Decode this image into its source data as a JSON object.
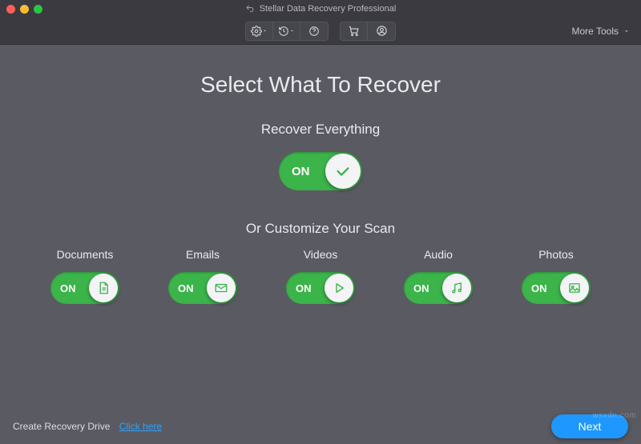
{
  "window": {
    "title": "Stellar Data Recovery Professional"
  },
  "toolbar": {
    "more_tools_label": "More Tools"
  },
  "main": {
    "heading": "Select What To Recover",
    "recover_everything_label": "Recover Everything",
    "customize_label": "Or Customize Your Scan",
    "toggle_on_label": "ON"
  },
  "categories": [
    {
      "key": "documents",
      "label": "Documents"
    },
    {
      "key": "emails",
      "label": "Emails"
    },
    {
      "key": "videos",
      "label": "Videos"
    },
    {
      "key": "audio",
      "label": "Audio"
    },
    {
      "key": "photos",
      "label": "Photos"
    }
  ],
  "footer": {
    "create_recovery_label": "Create Recovery Drive",
    "click_here_label": "Click here",
    "next_label": "Next"
  },
  "watermark": "wsxdn.com"
}
